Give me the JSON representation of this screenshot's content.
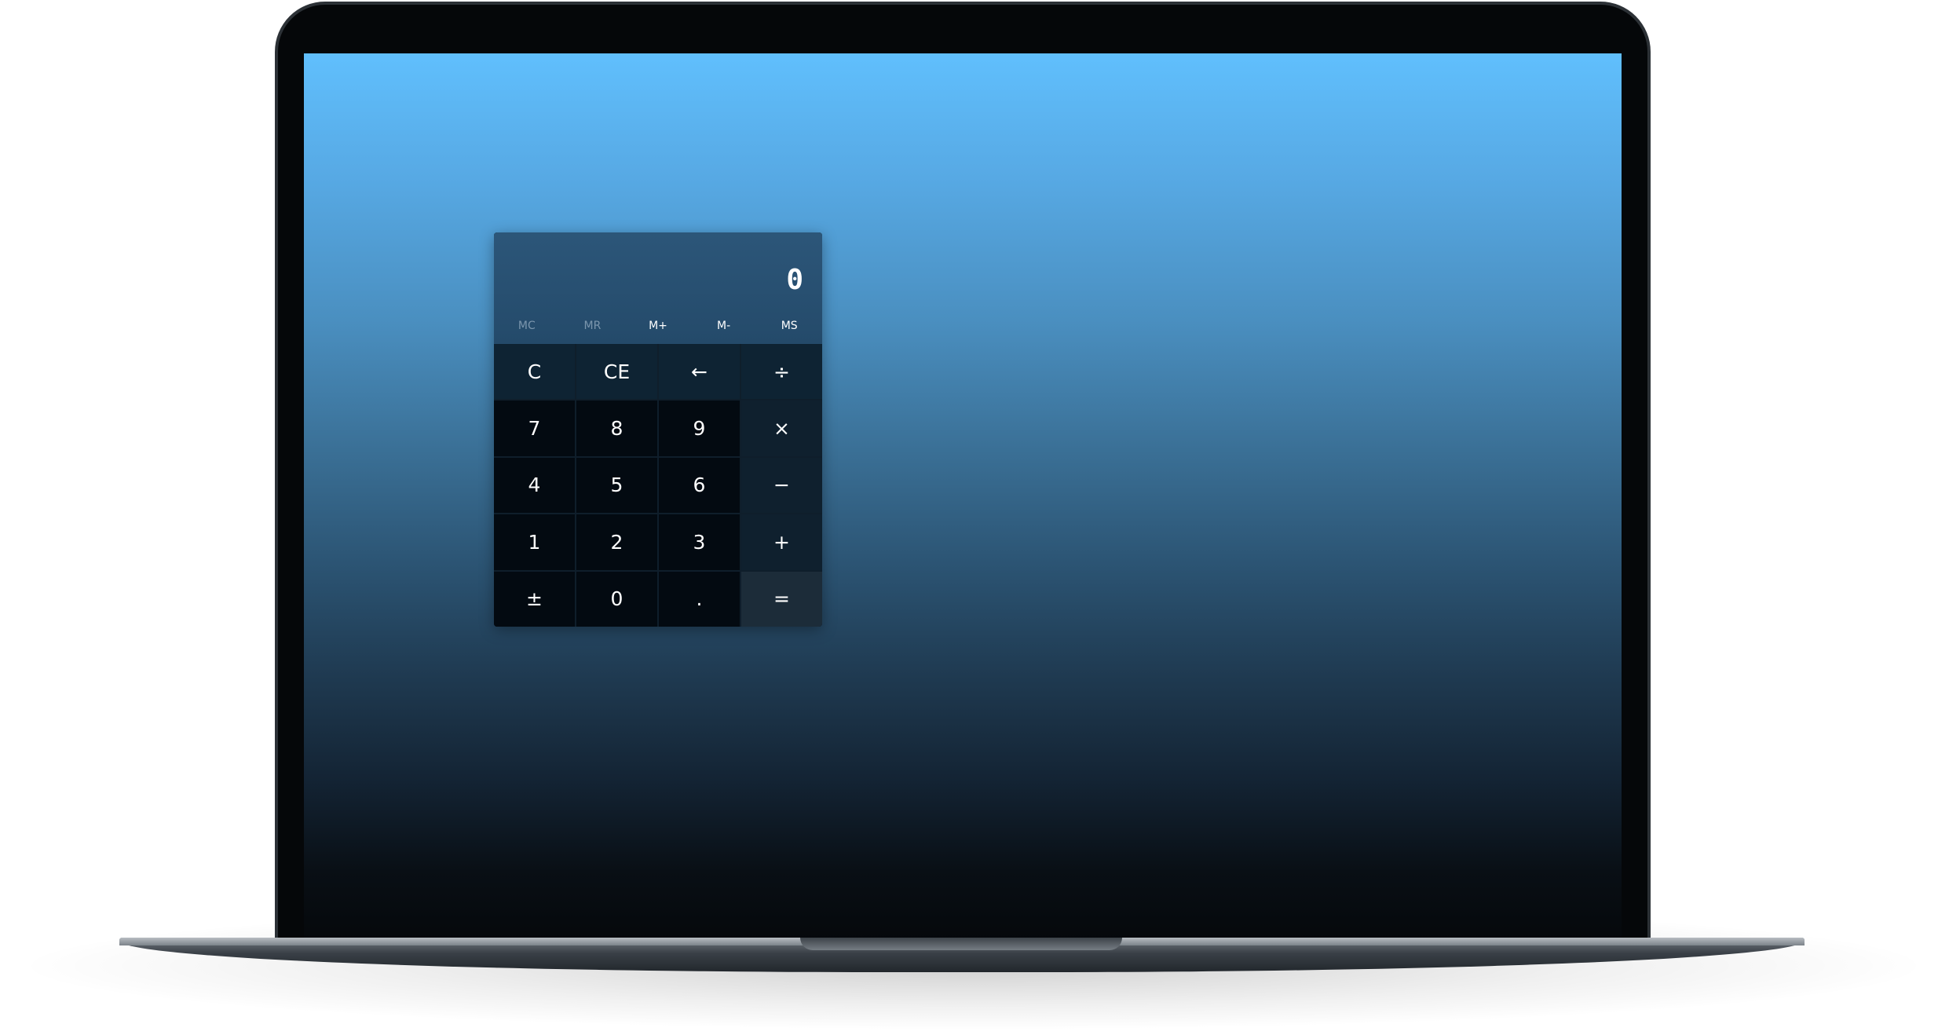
{
  "calculator": {
    "display": "0",
    "memory": [
      {
        "label": "MC",
        "name": "memory-clear-button",
        "enabled": false
      },
      {
        "label": "MR",
        "name": "memory-recall-button",
        "enabled": false
      },
      {
        "label": "M+",
        "name": "memory-add-button",
        "enabled": true
      },
      {
        "label": "M-",
        "name": "memory-subtract-button",
        "enabled": true
      },
      {
        "label": "MS",
        "name": "memory-store-button",
        "enabled": true
      }
    ],
    "keys": [
      {
        "label": "C",
        "name": "clear-button",
        "kind": "top"
      },
      {
        "label": "CE",
        "name": "clear-entry-button",
        "kind": "top"
      },
      {
        "label": "←",
        "name": "backspace-button",
        "kind": "top"
      },
      {
        "label": "÷",
        "name": "divide-button",
        "kind": "top"
      },
      {
        "label": "7",
        "name": "digit-7-button",
        "kind": "digit"
      },
      {
        "label": "8",
        "name": "digit-8-button",
        "kind": "digit"
      },
      {
        "label": "9",
        "name": "digit-9-button",
        "kind": "digit"
      },
      {
        "label": "×",
        "name": "multiply-button",
        "kind": "op"
      },
      {
        "label": "4",
        "name": "digit-4-button",
        "kind": "digit"
      },
      {
        "label": "5",
        "name": "digit-5-button",
        "kind": "digit"
      },
      {
        "label": "6",
        "name": "digit-6-button",
        "kind": "digit"
      },
      {
        "label": "−",
        "name": "subtract-button",
        "kind": "op"
      },
      {
        "label": "1",
        "name": "digit-1-button",
        "kind": "digit"
      },
      {
        "label": "2",
        "name": "digit-2-button",
        "kind": "digit"
      },
      {
        "label": "3",
        "name": "digit-3-button",
        "kind": "digit"
      },
      {
        "label": "+",
        "name": "add-button",
        "kind": "op"
      },
      {
        "label": "±",
        "name": "negate-button",
        "kind": "digit"
      },
      {
        "label": "0",
        "name": "digit-0-button",
        "kind": "digit"
      },
      {
        "label": ".",
        "name": "decimal-button",
        "kind": "digit"
      },
      {
        "label": "=",
        "name": "equals-button",
        "kind": "equals"
      }
    ]
  },
  "colors": {
    "screen_top": "#60bffd",
    "screen_bottom": "#05080b",
    "display_bg": "#2c5679",
    "digit_key": "#030a11",
    "operator_key": "#0f202e",
    "equals_key": "#1c2c39"
  }
}
